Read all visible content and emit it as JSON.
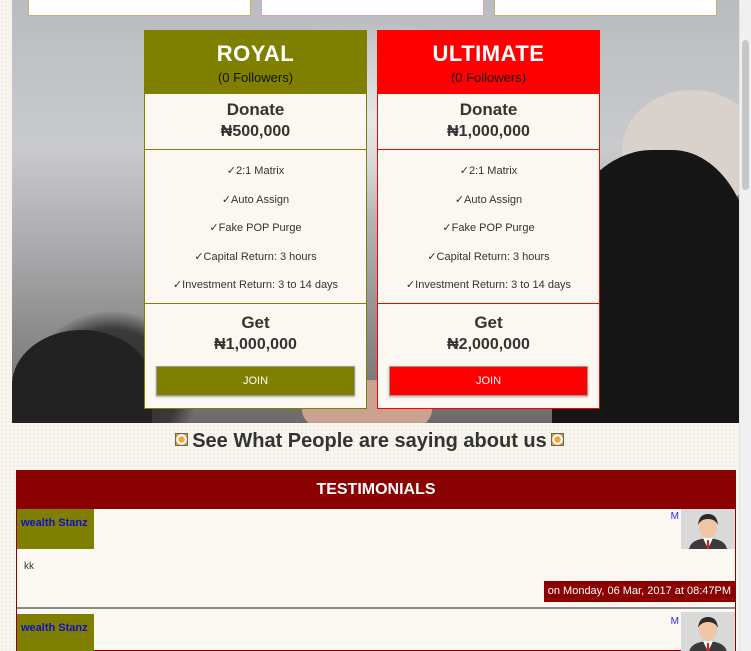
{
  "plans": [
    {
      "name": "ROYAL",
      "followers": "(0 Followers)",
      "donate_label": "Donate",
      "donate_amount": "₦500,000",
      "features": [
        "✓2:1 Matrix",
        "✓Auto Assign",
        "✓Fake POP Purge",
        "✓Capital Return: 3 hours",
        "✓Investment Return: 3 to 14 days"
      ],
      "get_label": "Get",
      "get_amount": "₦1,000,000",
      "join_label": "JOIN",
      "color": "#808000"
    },
    {
      "name": "ULTIMATE",
      "followers": "(0 Followers)",
      "donate_label": "Donate",
      "donate_amount": "₦1,000,000",
      "features": [
        "✓2:1 Matrix",
        "✓Auto Assign",
        "✓Fake POP Purge",
        "✓Capital Return: 3 hours",
        "✓Investment Return: 3 to 14 days"
      ],
      "get_label": "Get",
      "get_amount": "₦2,000,000",
      "join_label": "JOIN",
      "color": "#ff0000"
    }
  ],
  "testimonials_section": {
    "heading": "See What People are saying about us",
    "icon": "coin-icon",
    "title": "TESTIMONIALS",
    "accent": "#8b0000",
    "entries": [
      {
        "author": "wealth Stanz",
        "badge": "M",
        "avatar": "man-avatar-icon",
        "message": "kk",
        "date": "on Monday, 06 Mar, 2017 at 08:47PM"
      },
      {
        "author": "wealth Stanz",
        "badge": "M",
        "avatar": "man-avatar-icon"
      }
    ]
  }
}
